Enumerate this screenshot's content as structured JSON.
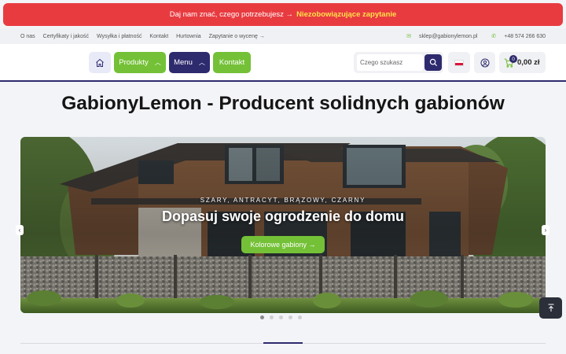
{
  "promo": {
    "text": "Daj nam znać, czego potrzebujesz →",
    "cta": "Niezobowiązujące zapytanie"
  },
  "topbar": {
    "links": [
      "O nas",
      "Certyfikaty i jakość",
      "Wysyłka i płatność",
      "Kontakt",
      "Hurtownia",
      "Zapytanie o wycenę →"
    ],
    "email": "sklep@gabionylemon.pl",
    "phone": "+48 574 266 630"
  },
  "nav": {
    "home_icon": "home-icon",
    "products": "Produkty",
    "menu": "Menu",
    "contact": "Kontakt"
  },
  "search": {
    "placeholder": "Czego szukasz",
    "icon": "search-icon"
  },
  "language": {
    "flag": "pl"
  },
  "cart": {
    "count": "0",
    "total": "0,00 zł"
  },
  "page_title": "GabionyLemon - Producent solidnych gabionów",
  "hero": {
    "subtitle": "SZARY, ANTRACYT, BRĄZOWY, CZARNY",
    "title": "Dopasuj swoje ogrodzenie do domu",
    "button": "Kolorowe gabiony →",
    "slides": 5,
    "active_slide": 1
  },
  "colors": {
    "accent_green": "#74c137",
    "brand_navy": "#2e2a6e",
    "promo_red": "#e83b40",
    "cta_yellow": "#ffe14a"
  }
}
